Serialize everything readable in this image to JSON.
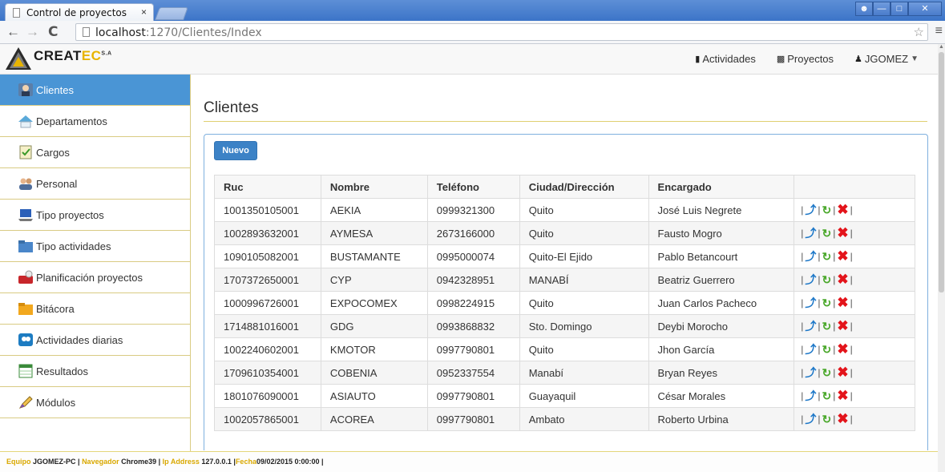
{
  "browser": {
    "tab_title": "Control de proyectos",
    "tab_close": "×",
    "url_host": "localhost",
    "url_path": ":1270/Clientes/Index",
    "back": "←",
    "forward": "→",
    "reload": "C",
    "star": "☆",
    "menu": "≡"
  },
  "app": {
    "logo": {
      "part1": "CREAT",
      "part2": "EC",
      "sa": "S.A"
    },
    "nav": [
      {
        "label": "Actividades",
        "icon": "activities-icon"
      },
      {
        "label": "Proyectos",
        "icon": "projects-icon"
      },
      {
        "label": "JGOMEZ",
        "icon": "user-icon"
      }
    ]
  },
  "sidebar": {
    "items": [
      {
        "label": "Clientes",
        "active": true
      },
      {
        "label": "Departamentos"
      },
      {
        "label": "Cargos"
      },
      {
        "label": "Personal"
      },
      {
        "label": "Tipo proyectos"
      },
      {
        "label": "Tipo actividades"
      },
      {
        "label": "Planificación proyectos"
      },
      {
        "label": "Bitácora"
      },
      {
        "label": "Actividades diarias"
      },
      {
        "label": "Resultados"
      },
      {
        "label": "Módulos"
      }
    ]
  },
  "main": {
    "title": "Clientes",
    "new_button": "Nuevo",
    "columns": [
      "Ruc",
      "Nombre",
      "Teléfono",
      "Ciudad/Dirección",
      "Encargado",
      ""
    ],
    "rows": [
      {
        "ruc": "1001350105001",
        "nombre": "AEKIA",
        "telefono": "0999321300",
        "ciudad": "Quito",
        "encargado": "José Luis Negrete"
      },
      {
        "ruc": "1002893632001",
        "nombre": "AYMESA",
        "telefono": "2673166000",
        "ciudad": "Quito",
        "encargado": "Fausto Mogro"
      },
      {
        "ruc": "1090105082001",
        "nombre": "BUSTAMANTE",
        "telefono": "0995000074",
        "ciudad": "Quito-El Ejido",
        "encargado": "Pablo Betancourt"
      },
      {
        "ruc": "1707372650001",
        "nombre": "CYP",
        "telefono": "0942328951",
        "ciudad": "MANABÍ",
        "encargado": "Beatriz Guerrero"
      },
      {
        "ruc": "1000996726001",
        "nombre": "EXPOCOMEX",
        "telefono": "0998224915",
        "ciudad": "Quito",
        "encargado": "Juan Carlos Pacheco"
      },
      {
        "ruc": "1714881016001",
        "nombre": "GDG",
        "telefono": "0993868832",
        "ciudad": "Sto. Domingo",
        "encargado": "Deybi Morocho"
      },
      {
        "ruc": "1002240602001",
        "nombre": "KMOTOR",
        "telefono": "0997790801",
        "ciudad": "Quito",
        "encargado": "Jhon García"
      },
      {
        "ruc": "1709610354001",
        "nombre": "COBENIA",
        "telefono": "0952337554",
        "ciudad": "Manabí",
        "encargado": "Bryan Reyes"
      },
      {
        "ruc": "1801076090001",
        "nombre": "ASIAUTO",
        "telefono": "0997790801",
        "ciudad": "Guayaquil",
        "encargado": "César Morales"
      },
      {
        "ruc": "1002057865001",
        "nombre": "ACOREA",
        "telefono": "0997790801",
        "ciudad": "Ambato",
        "encargado": "Roberto Urbina"
      }
    ]
  },
  "footer": {
    "equipo_label": "Equipo",
    "equipo": "JGOMEZ-PC",
    "navegador_label": "Navegador",
    "navegador": "Chrome39",
    "ip_label": "Ip Address",
    "ip": "127.0.0.1",
    "fecha_label": "Fecha",
    "fecha": "09/02/2015 0:00:00"
  }
}
